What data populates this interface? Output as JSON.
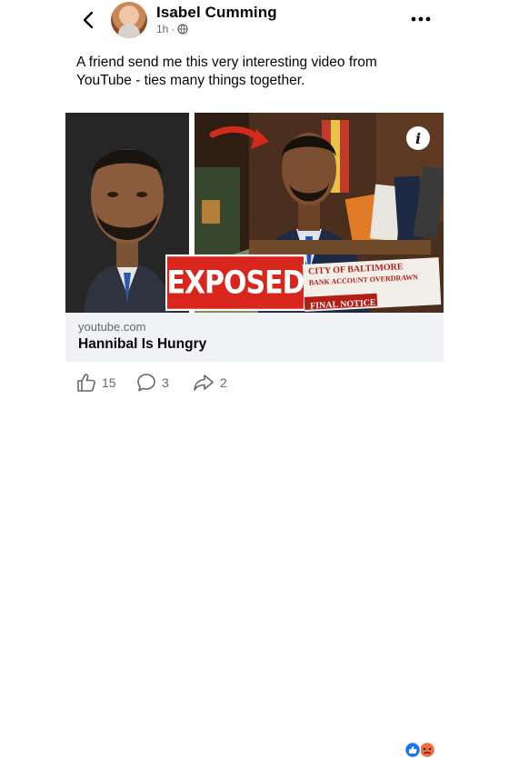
{
  "post": {
    "author": "Isabel Cumming",
    "time": "1h",
    "text": "A friend send me this very interesting video from YouTube - ties many things together."
  },
  "thumbnail": {
    "badge_text": "EXPOSED",
    "notice_lines": [
      "CITY OF BALTIMORE",
      "BANK ACCOUNT OVERDRAWN",
      "FINAL NOTICE"
    ]
  },
  "link": {
    "domain": "youtube.com",
    "title": "Hannibal Is Hungry"
  },
  "actions": {
    "likes": "15",
    "comments": "3",
    "shares": "2"
  },
  "colors": {
    "badge": "#d9261c",
    "like_blue": "#1877f2",
    "angry_orange": "#f06c3a"
  }
}
